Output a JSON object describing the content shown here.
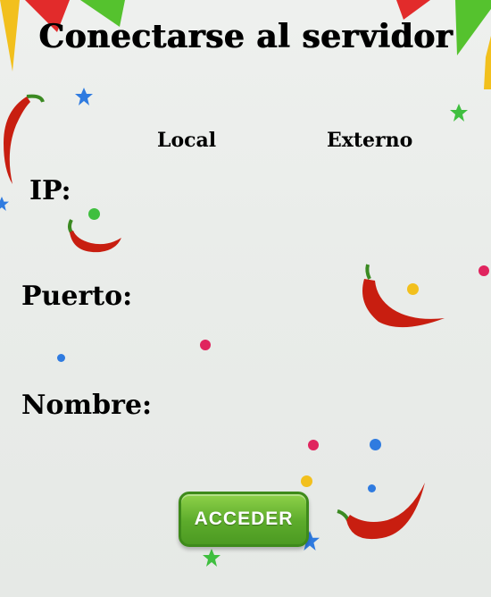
{
  "title": "Conectarse al servidor",
  "columns": {
    "local": "Local",
    "external": "Externo"
  },
  "fields": {
    "ip": {
      "label": "IP:",
      "local_value": "",
      "external_value": ""
    },
    "port": {
      "label": "Puerto:",
      "local_value": "",
      "external_value": ""
    },
    "name": {
      "label": "Nombre:",
      "value": ""
    }
  },
  "button": {
    "label": "ACCEDER"
  },
  "colors": {
    "button_green": "#5cab2b",
    "chili_red": "#c81e10",
    "confetti_pink": "#e0245e",
    "confetti_blue": "#2f7be0",
    "confetti_green": "#3fbf3f",
    "confetti_yellow": "#f2c01d"
  },
  "icons": [
    "pennant-banner-icon",
    "chili-pepper-icon",
    "star-icon",
    "confetti-dot-icon"
  ]
}
